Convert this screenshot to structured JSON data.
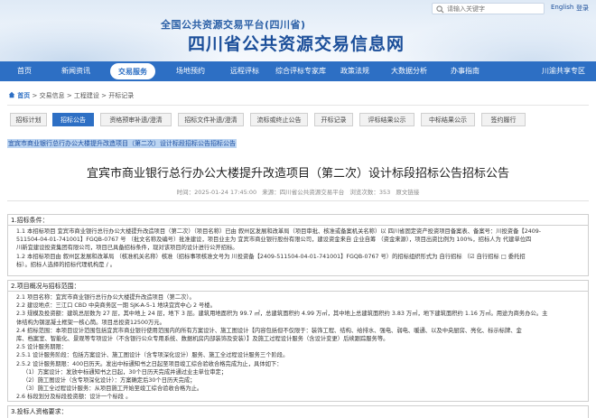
{
  "header": {
    "subtitle": "全国公共资源交易平台(四川省)",
    "title": "四川省公共资源交易信息网",
    "search_placeholder": "请输入关键字",
    "lang_label": "English",
    "login_label": "登录"
  },
  "nav": {
    "items": [
      "首页",
      "新闻资讯",
      "交易服务",
      "场地预约",
      "远程评标",
      "综合评标专家库",
      "政策法规",
      "大数据分析",
      "办事指南",
      "川渝共享专区"
    ],
    "active_index": 2
  },
  "breadcrumb": [
    "首页",
    "交易信息",
    "工程建设",
    "开标记录"
  ],
  "tabs": [
    "招标计划",
    "招标公告",
    "资格预审补遗/澄清",
    "招标文件补遗/澄清",
    "流标或终止公告",
    "开标记录",
    "评标结果公示",
    "中标结果公示",
    "签约履行"
  ],
  "active_tab": 1,
  "selected_title": "宜宾市商业银行总行办公大楼提升改造项目（第二次）设计标段招标公告招标公告",
  "article": {
    "title": "宜宾市商业银行总行办公大楼提升改造项目（第二次）设计标段招标公告招标公告",
    "meta": [
      "时间：2025-01-24 17:45:00",
      "来源：四川省公共资源交易平台",
      "浏览次数：353",
      "原文链接"
    ]
  },
  "sections": [
    {
      "head": "1.招标条件：",
      "lines": [
        "1.1 本招标项目 宜宾市商业银行总行办公大楼提升改造项目（第二次）（项目名称）已由 叙州区发展和改革局（项目审批、核准或备案机关名称）以 四川省固定资产投资项目备案表、备案号：川投资备【2409-",
        "511504-04-01-741001】FGQB-0767 号 （批文名称及编号）批准建设，项目业主为 宜宾市商业银行股份有限公司，建设资金来自 企业自筹 （资金来源），项目出资比例为 100%，招标人为 代建单位四",
        "川新宜建设投资集团有限公司，项目已具备招标条件，现对该项目的设计进行公开招标。",
        "1.2 本招标项目由 叙州区发展和改革局 （核准机关名称）核准（招标事项核准文号为 川投资备【2409-511504-04-01-741001】FGQB-0767 号）的招标组织形式为 自行招标 （☑ 自行招标 □ 委托招",
        "标）。招标人选择的招标代理机构是 / 。"
      ]
    },
    {
      "head": "2.项目概况与招标范围：",
      "lines": [
        "2.1 项目名称：宜宾市商业银行总行办公大楼提升改造项目（第二次）。",
        "2.2 建设地点：三江口 CBD 中央商务区一期 SJK-A-5-1 地块宜宾中心 2 号楼。",
        "2.3 规模及投资额：建筑总层数为 27 层，其中地上 24 层，地下 3 层。建筑用地面积为 99.7 ㎡，总建筑面积约 4.99 万㎡，其中地上总建筑面积约 3.83 万㎡，地下建筑面积约 1.16 万㎡。用途为商务办公。主",
        "体结构为钢混凝土框架一核心筒。项目总投资12500万元。",
        "2.4 招标范围：本项目设计范围包括宜宾市商业银行使用范围内的所有方案设计、施工图设计【内容包括但不仅限于：装饰工程、结构、给排水、强电、弱电、暖通、以及中央厨房、亮化、标示标牌、金",
        "库、档案室、智能化、景观等专项设计（不含银行公众专用系统、数据机房内部装饰及安装）】及施工过程设计服务（含设计变更）后续跟踪服务等。",
        "2.5 设计服务期限：",
        "2.5.1 设计服务阶段：包括方案设计、施工图设计（含专项深化设计）服务、施工全过程设计服务三个阶段。",
        "2.5.2 设计服务期限：400日历天。发出中标通知书之日起至项目竣工综合验收合格完成为止，具体如下：",
        "（1）方案设计：发放中标通知书之日起，30个日历天完成并通过业主单位审定；",
        "（2）施工图设计（含专项深化设计）：方案确定后30个日历天完成；",
        "（3）施工全过程设计服务：从项目施工开始至竣工综合验收合格为止。",
        "2.6 标段划分及标段投资额：设计一个标段 。"
      ]
    },
    {
      "head": "3.投标人资格要求：",
      "lines": []
    }
  ]
}
